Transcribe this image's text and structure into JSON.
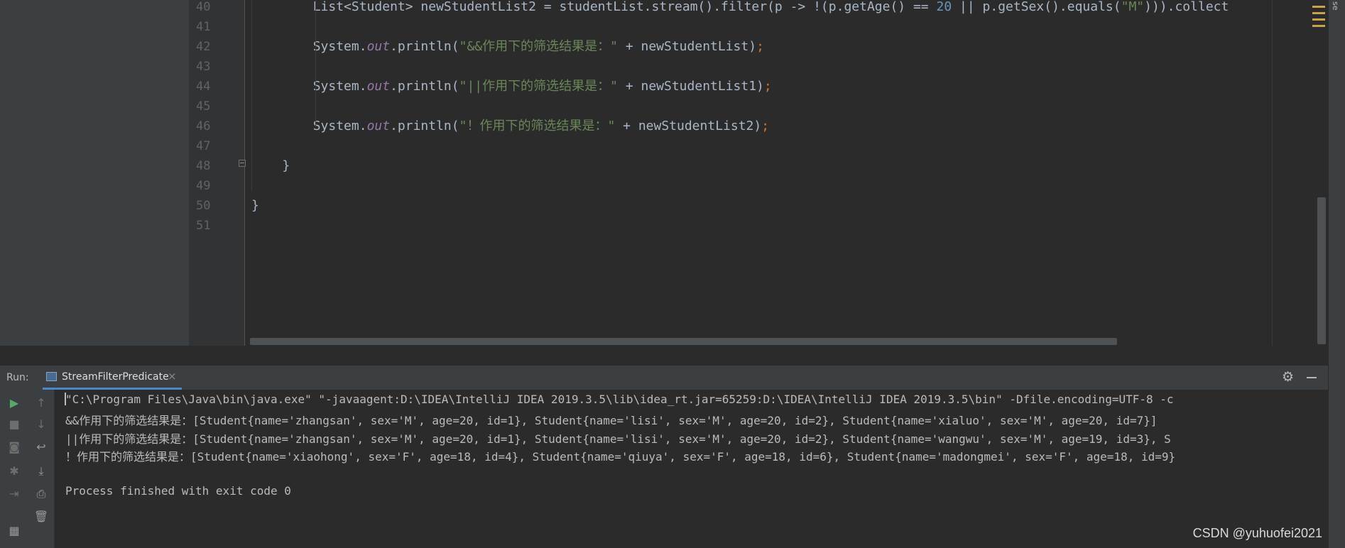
{
  "editor": {
    "lines": [
      {
        "num": "40",
        "tokens": [
          {
            "t": "        List<Student> newStudentList2 = studentList.stream().filter(p -> !(p.getAge() == ",
            "c": ""
          },
          {
            "t": "20",
            "c": "kw-num"
          },
          {
            "t": " || p.getSex().equals(",
            "c": ""
          },
          {
            "t": "\"M\"",
            "c": "kw-str"
          },
          {
            "t": "))).collect",
            "c": ""
          }
        ]
      },
      {
        "num": "41",
        "tokens": []
      },
      {
        "num": "42",
        "tokens": [
          {
            "t": "        System.",
            "c": ""
          },
          {
            "t": "out",
            "c": "kw-field"
          },
          {
            "t": ".println(",
            "c": ""
          },
          {
            "t": "\"&&作用下的筛选结果是：\"",
            "c": "kw-str"
          },
          {
            "t": " + newStudentList)",
            "c": ""
          },
          {
            "t": ";",
            "c": "kw-semi"
          }
        ]
      },
      {
        "num": "43",
        "tokens": []
      },
      {
        "num": "44",
        "tokens": [
          {
            "t": "        System.",
            "c": ""
          },
          {
            "t": "out",
            "c": "kw-field"
          },
          {
            "t": ".println(",
            "c": ""
          },
          {
            "t": "\"||作用下的筛选结果是：\"",
            "c": "kw-str"
          },
          {
            "t": " + newStudentList1)",
            "c": ""
          },
          {
            "t": ";",
            "c": "kw-semi"
          }
        ]
      },
      {
        "num": "45",
        "tokens": []
      },
      {
        "num": "46",
        "tokens": [
          {
            "t": "        System.",
            "c": ""
          },
          {
            "t": "out",
            "c": "kw-field"
          },
          {
            "t": ".println(",
            "c": ""
          },
          {
            "t": "\"！作用下的筛选结果是：\"",
            "c": "kw-str"
          },
          {
            "t": " + newStudentList2)",
            "c": ""
          },
          {
            "t": ";",
            "c": "kw-semi"
          }
        ]
      },
      {
        "num": "47",
        "tokens": []
      },
      {
        "num": "48",
        "tokens": [
          {
            "t": "    }",
            "c": "kw-brace-hl"
          }
        ]
      },
      {
        "num": "49",
        "tokens": []
      },
      {
        "num": "50",
        "tokens": [
          {
            "t": "}",
            "c": ""
          }
        ]
      },
      {
        "num": "51",
        "tokens": []
      }
    ]
  },
  "run_panel": {
    "label": "Run:",
    "tab_label": "StreamFilterPredicate",
    "tab_close": "×",
    "settings_icon": "gear-icon",
    "minimize_icon": "minimize-icon",
    "console_lines": [
      "\"C:\\Program Files\\Java\\bin\\java.exe\" \"-javaagent:D:\\IDEA\\IntelliJ IDEA 2019.3.5\\lib\\idea_rt.jar=65259:D:\\IDEA\\IntelliJ IDEA 2019.3.5\\bin\" -Dfile.encoding=UTF-8 -c",
      "&&作用下的筛选结果是：[Student{name='zhangsan', sex='M', age=20, id=1}, Student{name='lisi', sex='M', age=20, id=2}, Student{name='xialuo', sex='M', age=20, id=7}]",
      "||作用下的筛选结果是：[Student{name='zhangsan', sex='M', age=20, id=1}, Student{name='lisi', sex='M', age=20, id=2}, Student{name='wangwu', sex='M', age=19, id=3}, S",
      "！作用下的筛选结果是：[Student{name='xiaohong', sex='F', age=18, id=4}, Student{name='qiuya', sex='F', age=18, id=6}, Student{name='madongmei', sex='F', age=18, id=9}",
      "",
      "Process finished with exit code 0"
    ]
  },
  "watermark": "CSDN @yuhuofei2021",
  "right_strip_label": "se",
  "colors": {
    "string": "#6a8759",
    "number": "#6897bb",
    "field": "#9876aa",
    "semicolon": "#cc7832",
    "run_icon": "#59a869",
    "tab_underline": "#4a88c7"
  }
}
